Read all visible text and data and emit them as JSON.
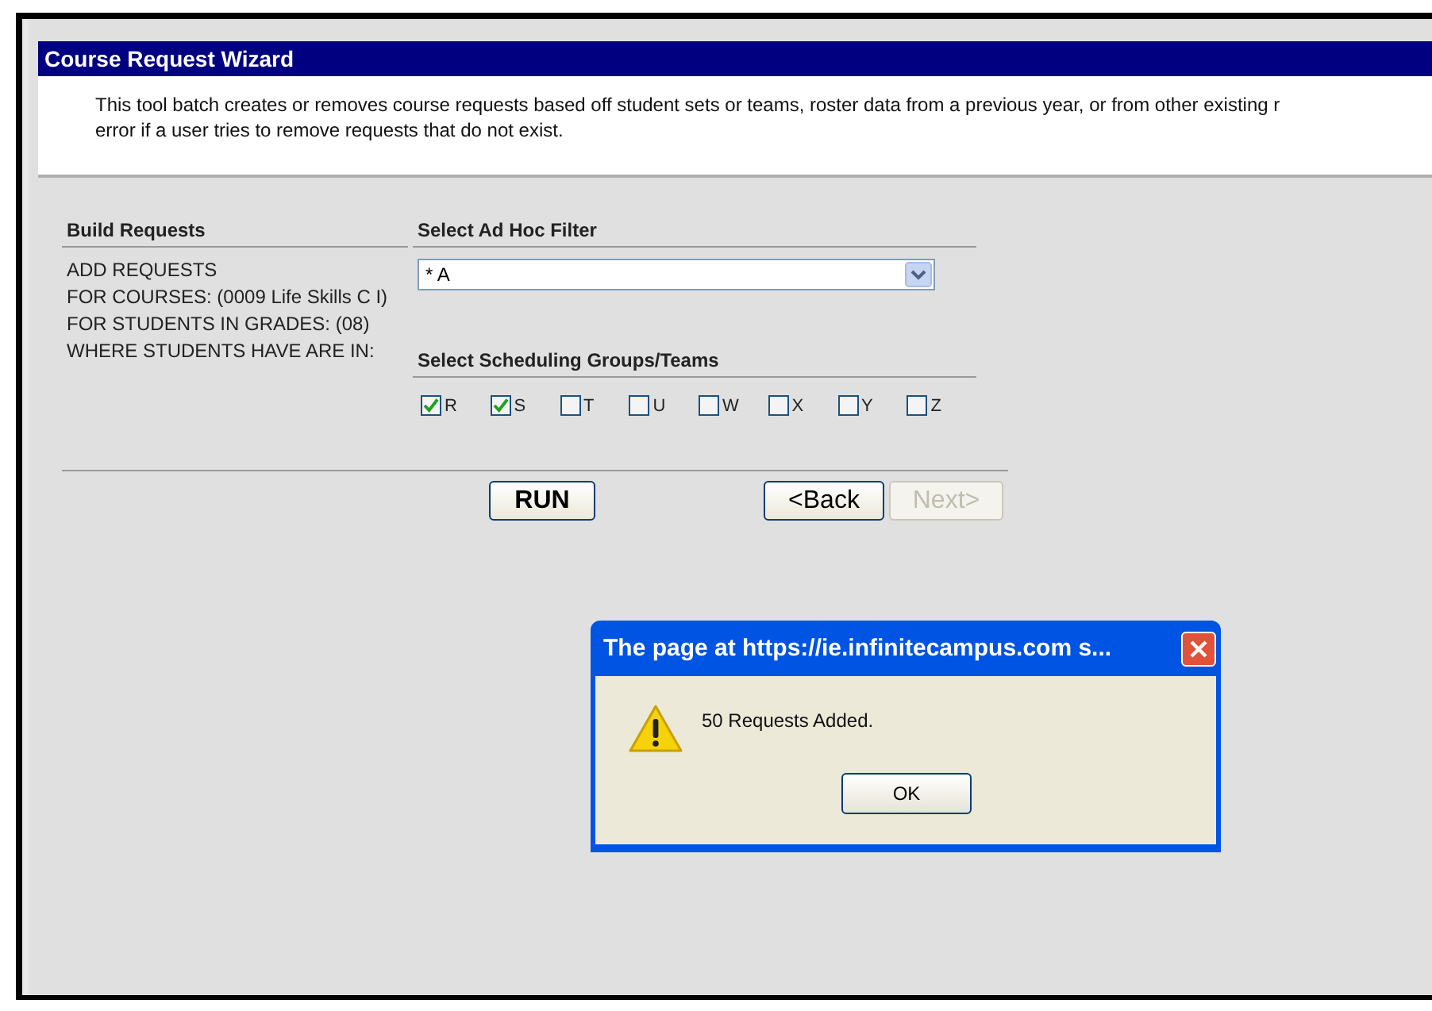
{
  "wizard": {
    "title": "Course Request Wizard",
    "description": [
      "This tool batch creates or removes course requests based off student sets or teams, roster data from a previous year, or from other existing r",
      "error if a user tries to remove requests that do not exist."
    ]
  },
  "build_requests": {
    "heading": "Build Requests",
    "lines": [
      "ADD REQUESTS",
      "FOR COURSES: (0009 Life Skills C I)",
      "FOR STUDENTS IN GRADES: (08)",
      "WHERE STUDENTS HAVE ARE IN:"
    ]
  },
  "ad_hoc_filter": {
    "heading": "Select Ad Hoc Filter",
    "value": "* A"
  },
  "scheduling_groups": {
    "heading": "Select Scheduling Groups/Teams",
    "items": [
      {
        "label": "R",
        "checked": true
      },
      {
        "label": "S",
        "checked": true
      },
      {
        "label": "T",
        "checked": false
      },
      {
        "label": "U",
        "checked": false
      },
      {
        "label": "W",
        "checked": false
      },
      {
        "label": "X",
        "checked": false
      },
      {
        "label": "Y",
        "checked": false
      },
      {
        "label": "Z",
        "checked": false
      }
    ]
  },
  "buttons": [
    {
      "label": "RUN",
      "kind": "run",
      "disabled": false
    },
    {
      "label": "<Back",
      "kind": "nav",
      "disabled": false
    },
    {
      "label": "Next>",
      "kind": "nav",
      "disabled": true
    }
  ],
  "dialog": {
    "title": "The page at https://ie.infinitecampus.com s...",
    "message": "50 Requests Added.",
    "button": "OK"
  }
}
